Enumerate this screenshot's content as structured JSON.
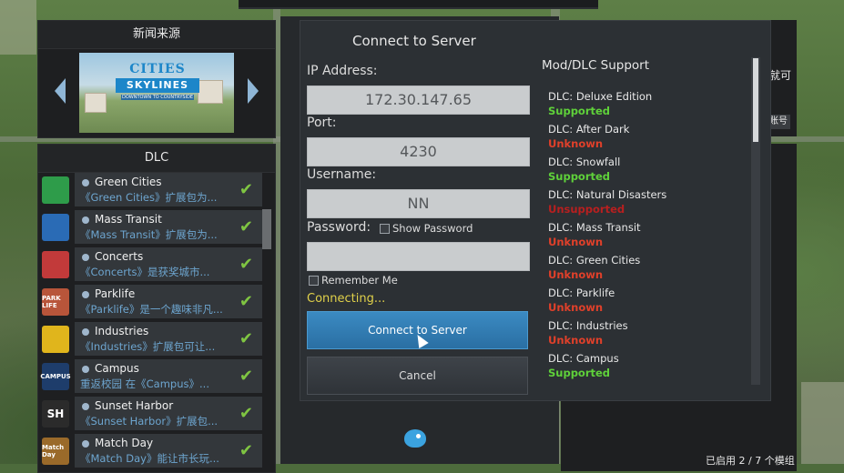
{
  "news": {
    "title": "新闻来源",
    "banner_line1": "CITIES",
    "banner_line2": "SKYLINES",
    "banner_line3": "DOWNTOWN TO COUNTRYSIDE"
  },
  "dlc_panel": {
    "title": "DLC",
    "items": [
      {
        "name": "Green Cities",
        "desc": "《Green Cities》扩展包为...",
        "icon": "leaf-icon",
        "icon_color": "#2e9c4a",
        "icon_text": ""
      },
      {
        "name": "Mass Transit",
        "desc": "《Mass Transit》扩展包为...",
        "icon": "transit-sign-icon",
        "icon_color": "#2a6bb5",
        "icon_text": ""
      },
      {
        "name": "Concerts",
        "desc": "《Concerts》是获奖城市...",
        "icon": "concert-icon",
        "icon_color": "#c23a3a",
        "icon_text": ""
      },
      {
        "name": "Parklife",
        "desc": "《Parklife》是一个趣味非凡...",
        "icon": "park-life-icon",
        "icon_color": "#b8553a",
        "icon_text": "PARK LIFE"
      },
      {
        "name": "Industries",
        "desc": "《Industries》扩展包可让...",
        "icon": "factory-icon",
        "icon_color": "#e0b51c",
        "icon_text": ""
      },
      {
        "name": "Campus",
        "desc": "重返校园 在《Campus》...",
        "icon": "campus-book-icon",
        "icon_color": "#1e3d6b",
        "icon_text": "CAMPUS"
      },
      {
        "name": "Sunset Harbor",
        "desc": "《Sunset Harbor》扩展包...",
        "icon": "sunset-harbor-icon",
        "icon_color": "#2b2b2b",
        "icon_text": "SH"
      },
      {
        "name": "Match Day",
        "desc": "《Match Day》能让市长玩...",
        "icon": "match-day-icon",
        "icon_color": "#9a6a2a",
        "icon_text": "Match Day"
      }
    ]
  },
  "right_bg": {
    "text1": "就可",
    "button": "账号",
    "status": "已启用 2 / 7 个模组"
  },
  "dialog": {
    "title": "Connect to Server",
    "ip_label": "IP Address:",
    "ip_value": "172.30.147.65",
    "port_label": "Port:",
    "port_value": "4230",
    "username_label": "Username:",
    "username_value": "NN",
    "password_label": "Password:",
    "password_value": "",
    "show_password_label": "Show Password",
    "remember_me_label": "Remember Me",
    "status": "Connecting...",
    "connect_button": "Connect to Server",
    "cancel_button": "Cancel",
    "mod_support_title": "Mod/DLC Support",
    "mods": [
      {
        "name": "DLC: Deluxe Edition",
        "status": "Supported",
        "color": "#5fd13a"
      },
      {
        "name": "DLC: After Dark",
        "status": "Unknown",
        "color": "#e0402a"
      },
      {
        "name": "DLC: Snowfall",
        "status": "Supported",
        "color": "#5fd13a"
      },
      {
        "name": "DLC: Natural Disasters",
        "status": "Unsupported",
        "color": "#b81f1f"
      },
      {
        "name": "DLC: Mass Transit",
        "status": "Unknown",
        "color": "#e0402a"
      },
      {
        "name": "DLC: Green Cities",
        "status": "Unknown",
        "color": "#e0402a"
      },
      {
        "name": "DLC: Parklife",
        "status": "Unknown",
        "color": "#e0402a"
      },
      {
        "name": "DLC: Industries",
        "status": "Unknown",
        "color": "#e0402a"
      },
      {
        "name": "DLC: Campus",
        "status": "Supported",
        "color": "#5fd13a"
      }
    ]
  }
}
